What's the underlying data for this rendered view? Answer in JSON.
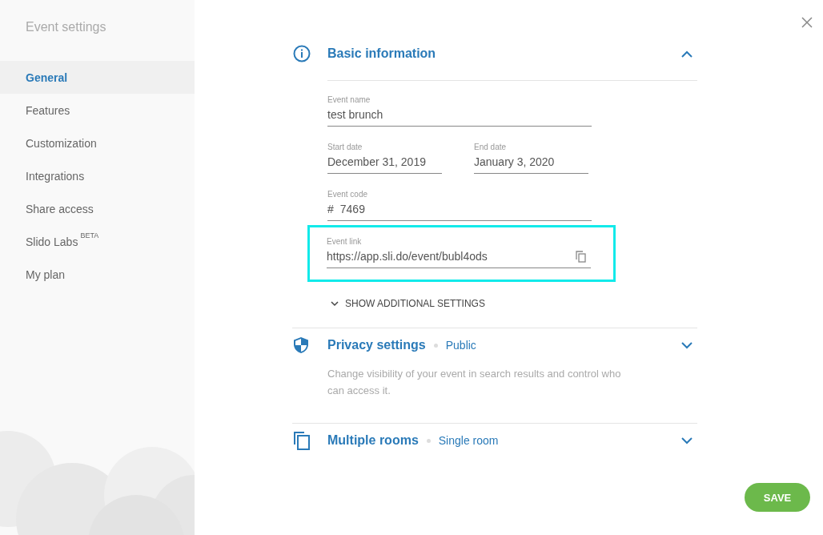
{
  "sidebar": {
    "title": "Event settings",
    "items": [
      {
        "label": "General",
        "selected": true
      },
      {
        "label": "Features",
        "selected": false
      },
      {
        "label": "Customization",
        "selected": false
      },
      {
        "label": "Integrations",
        "selected": false
      },
      {
        "label": "Share access",
        "selected": false
      },
      {
        "label": "Slido Labs",
        "badge": "BETA",
        "selected": false
      },
      {
        "label": "My plan",
        "selected": false
      }
    ]
  },
  "sections": [
    {
      "kind": "info",
      "title": "Basic information",
      "expanded": true,
      "rows": [
        {
          "fields": [
            {
              "kind": "text",
              "label": "Event name",
              "value": "test brunch"
            }
          ]
        },
        {
          "fields": [
            {
              "kind": "date",
              "label": "Start date",
              "value": "December 31, 2019"
            },
            {
              "kind": "date",
              "label": "End date",
              "value": "January 3, 2020"
            }
          ]
        },
        {
          "fields": [
            {
              "kind": "code",
              "label": "Event code",
              "prefix": "#",
              "value": "7469"
            }
          ]
        },
        {
          "fields": [
            {
              "kind": "link",
              "label": "Event link",
              "value": "https://app.sli.do/event/bubl4ods",
              "highlighted": true
            }
          ]
        }
      ],
      "more": "SHOW ADDITIONAL SETTINGS"
    },
    {
      "kind": "shield",
      "title": "Privacy settings",
      "status": "Public",
      "expanded": false,
      "description": "Change visibility of your event in search results and control who can access it."
    },
    {
      "kind": "copy",
      "title": "Multiple rooms",
      "status": "Single room",
      "expanded": false
    }
  ],
  "save": "SAVE"
}
